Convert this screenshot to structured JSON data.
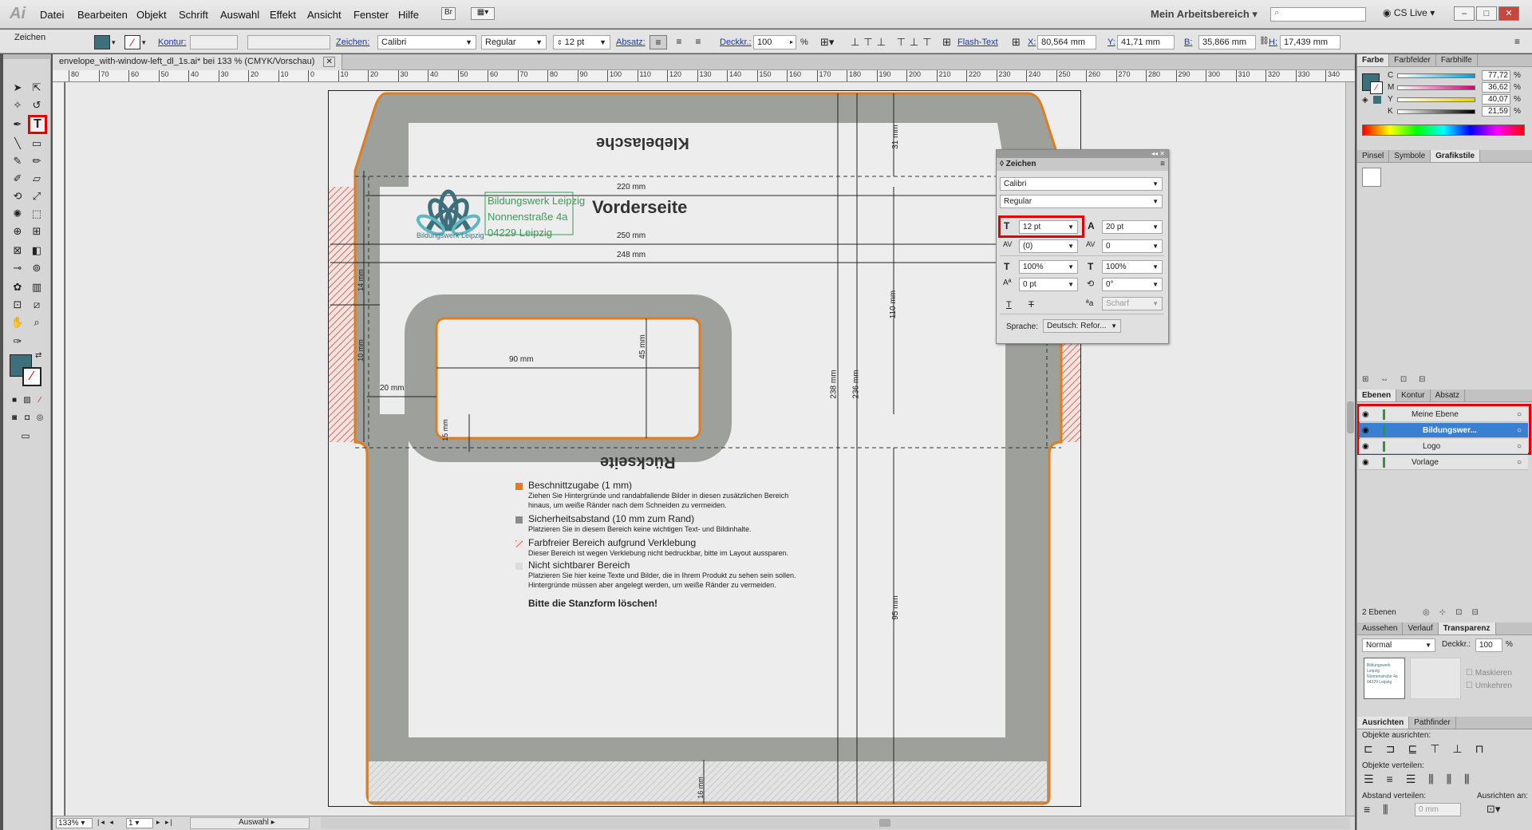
{
  "app": {
    "logo": "Ai"
  },
  "menu": [
    "Datei",
    "Bearbeiten",
    "Objekt",
    "Schrift",
    "Auswahl",
    "Effekt",
    "Ansicht",
    "Fenster",
    "Hilfe"
  ],
  "workspace": {
    "label": "Mein Arbeitsbereich",
    "cs_live": "CS Live"
  },
  "controlbar": {
    "mode_label": "Zeichen",
    "kontur_label": "Kontur:",
    "zeichen_label": "Zeichen:",
    "font": "Calibri",
    "style": "Regular",
    "size": "12 pt",
    "absatz_label": "Absatz:",
    "opacity_label": "Deckkr.:",
    "opacity": "100",
    "pct": "%",
    "flash_text": "Flash-Text",
    "x_label": "X:",
    "x": "80,564 mm",
    "y_label": "Y:",
    "y": "41,71 mm",
    "b_label": "B:",
    "b": "35,866 mm",
    "h_label": "H:",
    "h": "17,439 mm"
  },
  "document_tab": {
    "title": "envelope_with-window-left_dl_1s.ai* bei 133 % (CMYK/Vorschau)"
  },
  "ruler_ticks": [
    "80",
    "70",
    "60",
    "50",
    "40",
    "30",
    "20",
    "10",
    "0",
    "10",
    "20",
    "30",
    "40",
    "50",
    "60",
    "70",
    "80",
    "90",
    "100",
    "110",
    "120",
    "130",
    "140",
    "150",
    "160",
    "170",
    "180",
    "190",
    "200",
    "210",
    "220",
    "230",
    "240",
    "250",
    "260",
    "270",
    "280",
    "290",
    "300",
    "310",
    "320",
    "330",
    "340"
  ],
  "envelope": {
    "flap_title": "Klebelasche",
    "front_title": "Vorderseite",
    "back_title": "Rückseite",
    "address": [
      "Bildungswerk Leipzig",
      "Nonnenstraße 4a",
      "04229 Leipzig"
    ],
    "logo_caption": "Bildungswerk Leipzig",
    "dimensions": {
      "d220": "220 mm",
      "d250": "250 mm",
      "d248": "248 mm",
      "d90": "90 mm",
      "d45": "45 mm",
      "d20": "20 mm",
      "d15": "15 mm",
      "d14": "14 mm",
      "d10": "10 mm",
      "d31": "31 mm",
      "d110": "110 mm",
      "d238": "238 mm",
      "d236": "236 mm",
      "d95": "95 mm",
      "d16": "16 mm"
    }
  },
  "legend": [
    {
      "title": "Beschnittzugabe (1 mm)",
      "text": "Ziehen Sie Hintergründe und randabfallende Bilder in diesen zusätzlichen Bereich hinaus, um weiße Ränder nach dem Schneiden zu vermeiden.",
      "color": "#e07d1e"
    },
    {
      "title": "Sicherheitsabstand (10 mm zum Rand)",
      "text": "Platzieren Sie in diesem Bereich keine wichtigen Text- und Bildinhalte.",
      "color": "#8a8a8a"
    },
    {
      "title": "Farbfreier Bereich aufgrund Verklebung",
      "text": "Dieser Bereich ist wegen Verklebung nicht bedruckbar, bitte im Layout aussparen.",
      "color": "#d96a58"
    },
    {
      "title": "Nicht sichtbarer Bereich",
      "text": "Platzieren Sie hier keine Texte und Bilder, die in Ihrem Produkt zu sehen sein sollen. Hintergründe müssen aber angelegt werden, um weiße Ränder zu vermeiden.",
      "color": "#dcdcdc"
    }
  ],
  "legend_footer": "Bitte die Stanzform löschen!",
  "char_panel": {
    "title": "Zeichen",
    "font": "Calibri",
    "style": "Regular",
    "size": "12 pt",
    "leading": "20 pt",
    "kerning": "(0)",
    "tracking": "0",
    "vscale": "100%",
    "hscale": "100%",
    "baseline": "0 pt",
    "rotation": "0°",
    "aa": "Scharf",
    "lang_label": "Sprache:",
    "lang": "Deutsch: Refor..."
  },
  "color_panel": {
    "tabs": [
      "Farbe",
      "Farbfelder",
      "Farbhilfe"
    ],
    "rows": [
      {
        "ch": "C",
        "val": "77,72",
        "color": "#00a0d6"
      },
      {
        "ch": "M",
        "val": "36,62",
        "color": "#d4007a"
      },
      {
        "ch": "Y",
        "val": "40,07",
        "color": "#e8d200"
      },
      {
        "ch": "K",
        "val": "21,59",
        "color": "#000000"
      }
    ],
    "pct": "%",
    "fill": "#3e6f7c"
  },
  "brush_tabs": [
    "Pinsel",
    "Symbole",
    "Grafikstile"
  ],
  "layers_tabs": [
    "Ebenen",
    "Kontur",
    "Absatz"
  ],
  "layers": [
    {
      "name": "Meine Ebene",
      "indent": 0,
      "selected": false
    },
    {
      "name": "Bildungswer...",
      "indent": 1,
      "selected": true
    },
    {
      "name": "Logo",
      "indent": 1,
      "selected": false
    },
    {
      "name": "Vorlage",
      "indent": 0,
      "selected": false
    }
  ],
  "layers_count": "2 Ebenen",
  "transp_tabs": [
    "Aussehen",
    "Verlauf",
    "Transparenz"
  ],
  "transparency": {
    "mode": "Normal",
    "opacity_label": "Deckkr.:",
    "opacity": "100",
    "pct": "%",
    "mask": "Maskieren",
    "clip": "Umkehren",
    "thumb_lines": [
      "Bildungswerk Leipzig",
      "Nonnenstraße 4a",
      "04229 Leipzig"
    ]
  },
  "align_tabs": [
    "Ausrichten",
    "Pathfinder"
  ],
  "align": {
    "objects_align": "Objekte ausrichten:",
    "objects_distribute": "Objekte verteilen:",
    "spacing": "Abstand verteilen:",
    "align_to": "Ausrichten an:",
    "spacing_val": "0 mm"
  },
  "status": {
    "zoom": "133%",
    "page": "1",
    "mode": "Auswahl"
  }
}
